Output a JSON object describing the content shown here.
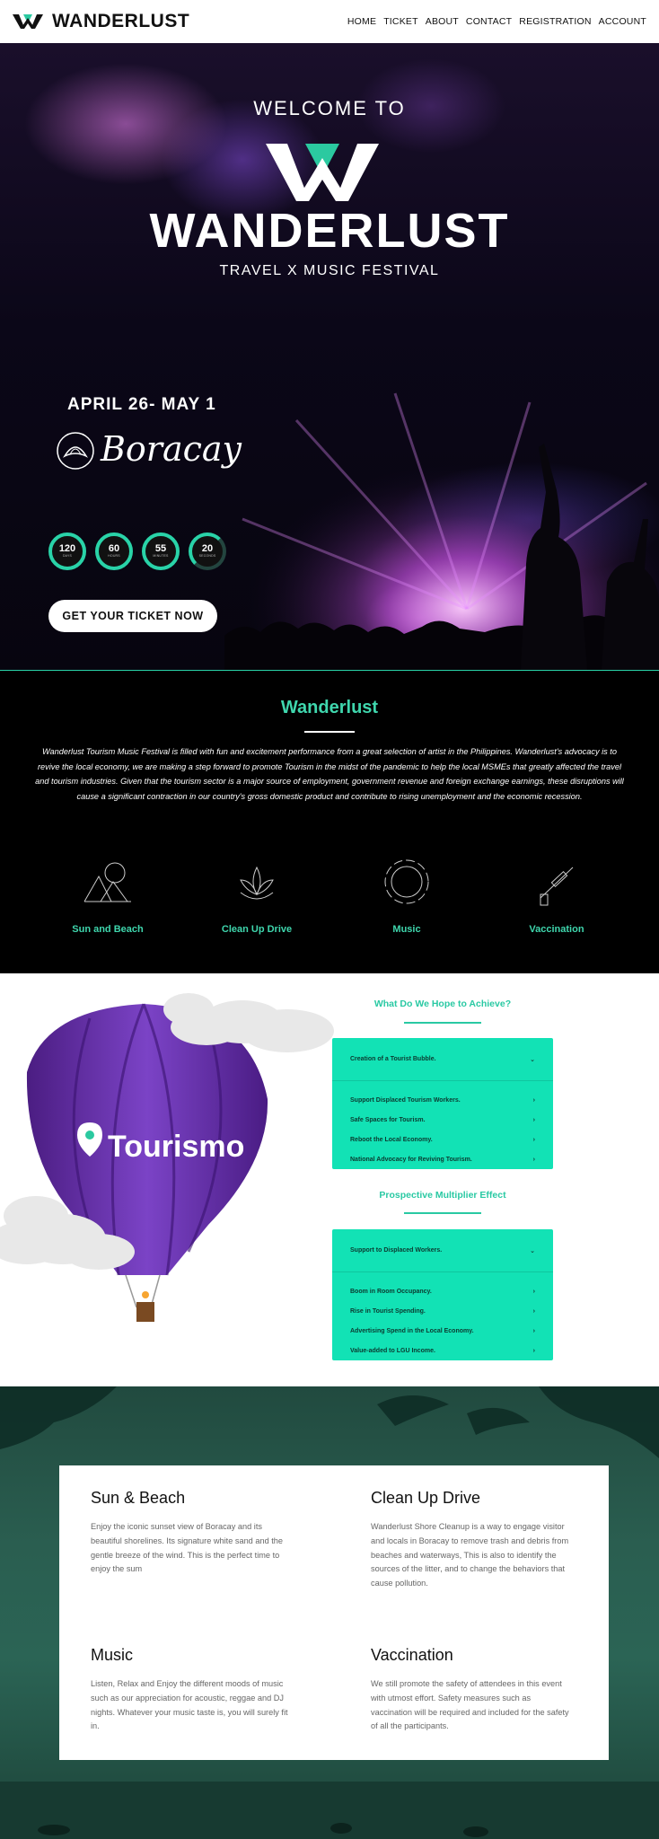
{
  "nav": {
    "brand": "WANDERLUST",
    "links": [
      "HOME",
      "TICKET",
      "ABOUT",
      "CONTACT",
      "REGISTRATION",
      "ACCOUNT"
    ]
  },
  "hero": {
    "welcome": "WELCOME TO",
    "title": "WANDERLUST",
    "subtitle": "TRAVEL X MUSIC FESTIVAL",
    "date": "APRIL 26- MAY 1",
    "venue_script": "Boracay",
    "countdown": [
      {
        "value": "120",
        "unit": "DAYS"
      },
      {
        "value": "60",
        "unit": "HOURS"
      },
      {
        "value": "55",
        "unit": "MINUTES"
      },
      {
        "value": "20",
        "unit": "SECONDS"
      }
    ],
    "cta": "GET YOUR TICKET NOW"
  },
  "about": {
    "title": "Wanderlust",
    "text": "Wanderlust Tourism Music Festival is filled with fun and excitement performance from a great selection of artist in the Philippines. Wanderlust's advocacy is to revive the local economy, we are making a step forward to promote Tourism in the midst of the pandemic to help the local MSMEs that greatly affected the travel and tourism industries. Given that the tourism sector is a major source of employment, government revenue and foreign exchange earnings, these disruptions will cause a significant contraction in our country's gross domestic product and contribute to rising unemployment and the economic recession.",
    "features": [
      {
        "label": "Sun and Beach",
        "icon": "mountain-sun-icon"
      },
      {
        "label": "Clean Up Drive",
        "icon": "leaf-icon"
      },
      {
        "label": "Music",
        "icon": "circle-sound-icon"
      },
      {
        "label": "Vaccination",
        "icon": "syringe-icon"
      }
    ]
  },
  "goals": {
    "balloon_text": "Tourismo",
    "achieve_title": "What Do We Hope to Achieve?",
    "achieve_head": "Creation of a Tourist Bubble.",
    "achieve_items": [
      "Support Displaced Tourism Workers.",
      "Safe Spaces for Tourism.",
      "Reboot the Local Economy.",
      "National Advocacy for Reviving Tourism."
    ],
    "multiplier_title": "Prospective Multiplier Effect",
    "multiplier_head": "Support to Displaced Workers.",
    "multiplier_items": [
      "Boom in Room Occupancy.",
      "Rise in Tourist Spending.",
      "Advertising Spend in the Local Economy.",
      "Value-added to LGU Income."
    ]
  },
  "activities": [
    {
      "title": "Sun & Beach",
      "text": "Enjoy the iconic sunset view of Boracay and its beautiful shorelines. Its signature white sand and the gentle breeze of the wind. This is the perfect time to enjoy the sum"
    },
    {
      "title": "Clean Up Drive",
      "text": "Wanderlust Shore Cleanup is a way to engage visitor and locals in Boracay to remove trash and debris from beaches and waterways, This is also to identify the sources of the litter, and to change the behaviors that cause pollution."
    },
    {
      "title": "Music",
      "text": "Listen, Relax and Enjoy the different moods of music such as our appreciation for acoustic, reggae and DJ nights. Whatever your music taste is, you will surely fit in."
    },
    {
      "title": "Vaccination",
      "text": "We still promote the safety of attendees in this event with utmost effort. Safety measures such as vaccination will be required and included for the safety of all the participants."
    }
  ],
  "colors": {
    "accent": "#29d3a8",
    "panel": "#12e2b5",
    "activities_bg": "#2a5e50"
  }
}
